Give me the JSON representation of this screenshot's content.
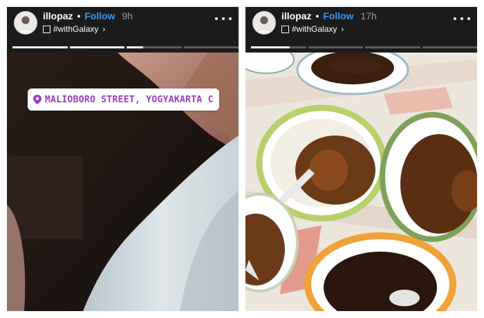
{
  "stories": [
    {
      "username": "illopaz",
      "separator": "•",
      "follow_label": "Follow",
      "time_ago": "9h",
      "tag": "#withGalaxy",
      "progress": [
        1.0,
        1.0,
        0.3,
        0.0
      ],
      "location_label": "MALIOBORO STREET, YOGYAKARTA CI..."
    },
    {
      "username": "illopaz",
      "separator": "•",
      "follow_label": "Follow",
      "time_ago": "17h",
      "tag": "#withGalaxy",
      "progress": [
        0.7,
        0.0,
        0.0,
        0.0
      ]
    }
  ],
  "icons": {
    "more": "more-options-icon",
    "location": "location-pin-icon",
    "chevron": "chevron-right-icon",
    "checkbox": "checkbox-icon"
  },
  "colors": {
    "follow": "#3897f0",
    "location_text": "#9b3bc9",
    "story_bg": "#1b1b1b"
  }
}
